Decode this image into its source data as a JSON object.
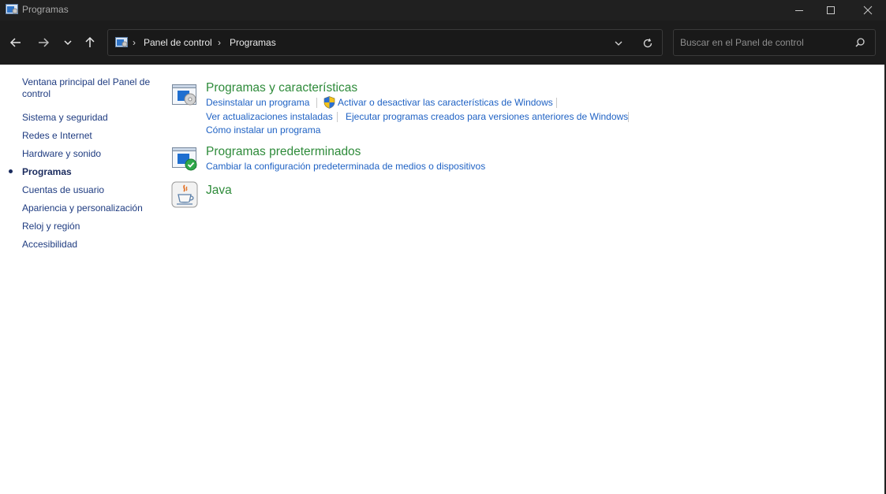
{
  "window": {
    "title": "Programas"
  },
  "nav": {
    "breadcrumb": [
      "Panel de control",
      "Programas"
    ],
    "search_placeholder": "Buscar en el Panel de control"
  },
  "sidebar": {
    "items": [
      {
        "label": "Ventana principal del Panel de control",
        "current": false
      },
      {
        "label": "Sistema y seguridad",
        "current": false
      },
      {
        "label": "Redes e Internet",
        "current": false
      },
      {
        "label": "Hardware y sonido",
        "current": false
      },
      {
        "label": "Programas",
        "current": true
      },
      {
        "label": "Cuentas de usuario",
        "current": false
      },
      {
        "label": "Apariencia y personalización",
        "current": false
      },
      {
        "label": "Reloj y región",
        "current": false
      },
      {
        "label": "Accesibilidad",
        "current": false
      }
    ]
  },
  "categories": [
    {
      "title": "Programas y características",
      "icon": "programs-features-icon",
      "tasks": [
        "Desinstalar un programa",
        "Activar o desactivar las características de Windows",
        "Ver actualizaciones instaladas",
        "Ejecutar programas creados para versiones anteriores de Windows",
        "Cómo instalar un programa"
      ]
    },
    {
      "title": "Programas predeterminados",
      "icon": "default-programs-icon",
      "tasks": [
        "Cambiar la configuración predeterminada de medios o dispositivos"
      ]
    },
    {
      "title": "Java",
      "icon": "java-icon",
      "tasks": []
    }
  ],
  "colors": {
    "category_title": "#2e8b3a",
    "task_link": "#1f62c4",
    "sidebar_link": "#1e3b80",
    "chrome_bg": "#202020"
  }
}
